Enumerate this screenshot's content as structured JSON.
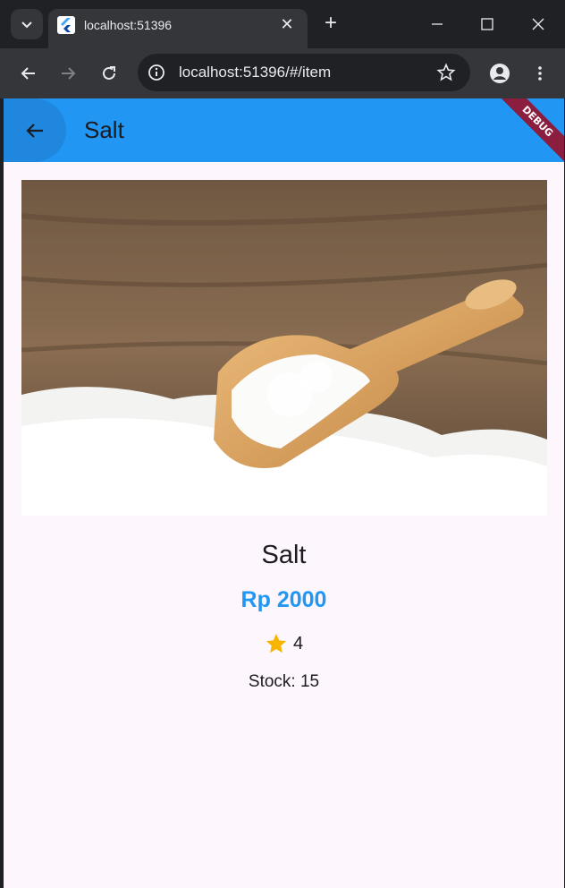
{
  "browser": {
    "tab_title": "localhost:51396",
    "url": "localhost:51396/#/item"
  },
  "app": {
    "title": "Salt",
    "debug_label": "DEBUG",
    "colors": {
      "app_bar": "#2196f3",
      "price": "#2196f3",
      "star": "#f7b500",
      "background": "#fdf6fd"
    }
  },
  "item": {
    "name": "Salt",
    "price": "Rp 2000",
    "rating": "4",
    "stock": "Stock: 15",
    "image_icon": "salt-scoop-photo"
  },
  "icons": {
    "back": "arrow-back-icon",
    "star": "star-icon"
  }
}
